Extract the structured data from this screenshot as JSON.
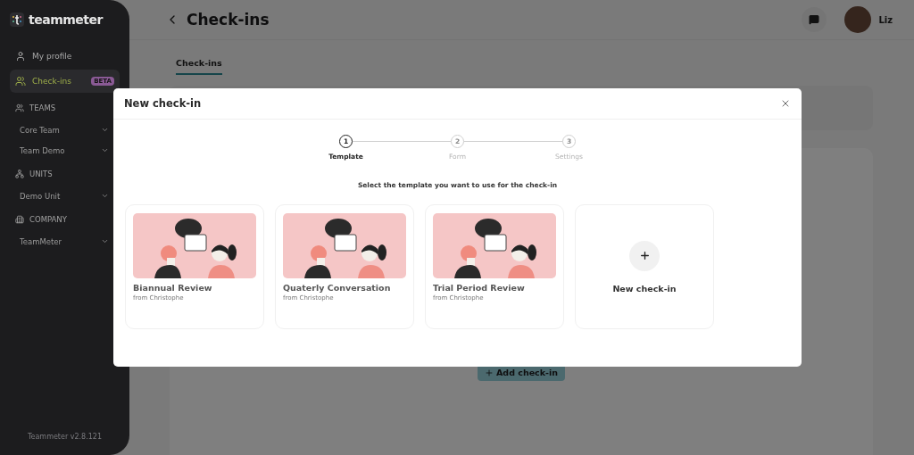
{
  "logo": {
    "text": "teammeter"
  },
  "sidebar": {
    "items": [
      {
        "kind": "link",
        "label": "My profile",
        "selected": false
      },
      {
        "kind": "link",
        "label": "Check-ins",
        "selected": true,
        "badge": "BETA"
      },
      {
        "kind": "section",
        "label": "TEAMS"
      },
      {
        "kind": "group",
        "label": "Core Team"
      },
      {
        "kind": "group",
        "label": "Team Demo"
      },
      {
        "kind": "section",
        "label": "UNITS"
      },
      {
        "kind": "group",
        "label": "Demo Unit"
      },
      {
        "kind": "section",
        "label": "COMPANY"
      },
      {
        "kind": "group",
        "label": "TeamMeter"
      }
    ],
    "version": "Teammeter v2.8.121"
  },
  "header": {
    "title": "Check-ins",
    "user": "Liz"
  },
  "tabs": [
    {
      "label": "Check-ins",
      "selected": true
    }
  ],
  "add_button": {
    "label": "Add check-in"
  },
  "modal": {
    "title": "New check-in",
    "steps": [
      {
        "number": "1",
        "label": "Template",
        "selected": true
      },
      {
        "number": "2",
        "label": "Form",
        "selected": false
      },
      {
        "number": "3",
        "label": "Settings",
        "selected": false
      }
    ],
    "prompt": "Select the template you want to use for the check-in",
    "templates": [
      {
        "kind": "template",
        "title": "Biannual Review",
        "author": "from Christophe"
      },
      {
        "kind": "template",
        "title": "Quaterly Conversation",
        "author": "from Christophe"
      },
      {
        "kind": "template",
        "title": "Trial Period Review",
        "author": "from Christophe"
      },
      {
        "kind": "new",
        "title": "New check-in"
      }
    ]
  }
}
